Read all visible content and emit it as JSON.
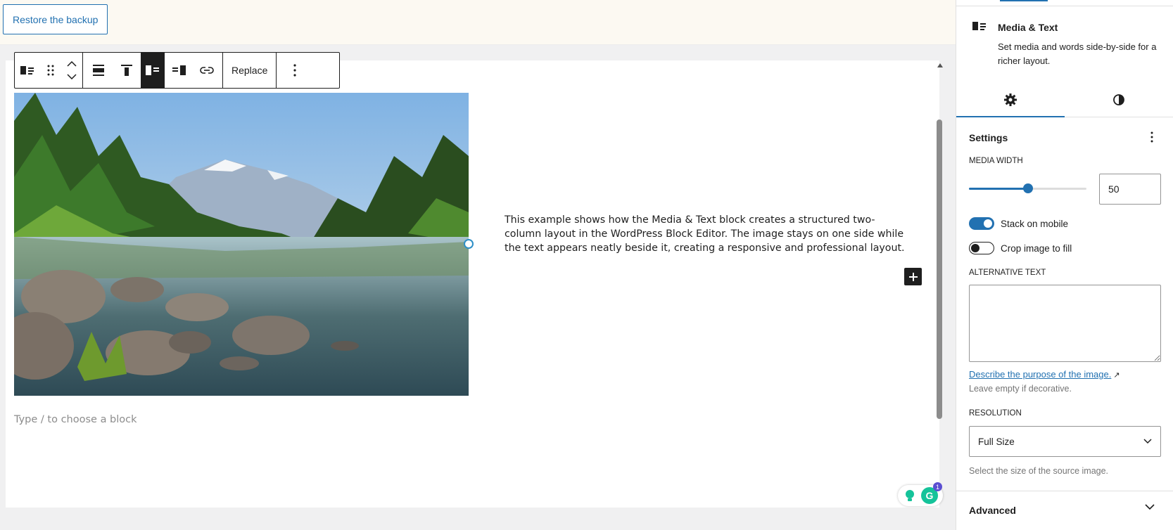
{
  "notice": {
    "restore_label": "Restore the backup"
  },
  "toolbar": {
    "block_type_icon": "media-text-icon",
    "replace_label": "Replace"
  },
  "block": {
    "text": "This example shows how the Media & Text block creates a structured two-column layout in the WordPress Block Editor. The image stays on one side while the text appears neatly beside it, creating a responsive and professional layout.",
    "image_icon": "landscape-photo"
  },
  "editor": {
    "placeholder": "Type / to choose a block"
  },
  "grammarly": {
    "badge_count": "1",
    "letter": "G"
  },
  "sidebar": {
    "block_card": {
      "title": "Media & Text",
      "description": "Set media and words side-by-side for a richer layout."
    },
    "settings": {
      "title": "Settings",
      "media_width_label": "MEDIA WIDTH",
      "media_width_value": "50",
      "media_width_fraction": 0.5,
      "stack_on_mobile_label": "Stack on mobile",
      "stack_on_mobile": true,
      "crop_label": "Crop image to fill",
      "crop": false,
      "alt_label": "ALTERNATIVE TEXT",
      "alt_value": "",
      "alt_link": "Describe the purpose of the image.",
      "alt_help": "Leave empty if decorative.",
      "resolution_label": "RESOLUTION",
      "resolution_value": "Full Size",
      "resolution_help": "Select the size of the source image."
    },
    "advanced_label": "Advanced"
  },
  "colors": {
    "accent": "#2271b1",
    "notice_bg": "#fcf9f2"
  }
}
